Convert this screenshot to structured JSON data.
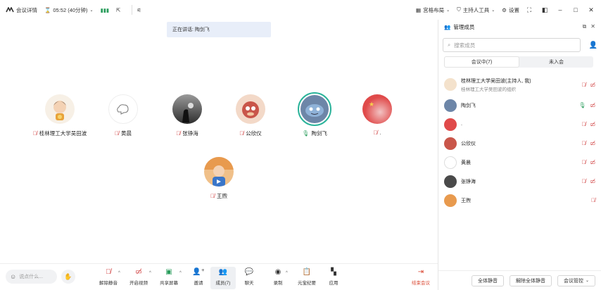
{
  "topbar": {
    "logo": "腾讯会议",
    "meeting_info": "会议详情",
    "timer": "05:52 (40分钟)",
    "layout_label": "宫格布局",
    "host_tools_label": "主持人工具",
    "settings_label": "设置"
  },
  "stage": {
    "speaking_text": "正在讲话: 陶剑飞",
    "participants": [
      {
        "name": "桂林理工大学吴田波",
        "mic": "off",
        "avatar_color": "#f4e2cc"
      },
      {
        "name": "黄晨",
        "mic": "off",
        "avatar_color": "#ffffff"
      },
      {
        "name": "张铮海",
        "mic": "off",
        "avatar_color": "#4a4a4a"
      },
      {
        "name": "公欣仪",
        "mic": "off",
        "avatar_color": "#c9564a"
      },
      {
        "name": "陶剑飞",
        "mic": "on",
        "avatar_color": "#6d86a8"
      },
      {
        "name": ".",
        "mic": "off",
        "avatar_color": "#e04a4a"
      },
      {
        "name": "王煦",
        "mic": "off",
        "avatar_color": "#e89a4e"
      }
    ]
  },
  "toolbar": {
    "chat_placeholder": "说点什么...",
    "tools": [
      {
        "label": "解除静音",
        "icon": "mic-off-icon"
      },
      {
        "label": "开启视频",
        "icon": "video-off-icon"
      },
      {
        "label": "共享屏幕",
        "icon": "share-screen-icon"
      },
      {
        "label": "邀请",
        "icon": "invite-icon"
      },
      {
        "label": "成员(7)",
        "icon": "members-icon"
      },
      {
        "label": "聊天",
        "icon": "chat-icon"
      },
      {
        "label": "录制",
        "icon": "record-icon"
      },
      {
        "label": "元宝纪要",
        "icon": "minutes-icon"
      },
      {
        "label": "应用",
        "icon": "apps-icon"
      }
    ],
    "end_label": "结束会议"
  },
  "panel": {
    "title": "管理成员",
    "search_placeholder": "搜索成员",
    "tab_in": "会议中(7)",
    "tab_out": "未入会",
    "members": [
      {
        "name": "桂林理工大学吴田波(主持人, 我)",
        "sub": "桂林理工大学吴田波的组织",
        "mic": "off",
        "color": "#f4e2cc"
      },
      {
        "name": "陶剑飞",
        "sub": "",
        "mic": "on",
        "color": "#6d86a8"
      },
      {
        "name": ".",
        "sub": "",
        "mic": "off",
        "color": "#e04a4a"
      },
      {
        "name": "公欣仪",
        "sub": "",
        "mic": "off",
        "color": "#c9564a"
      },
      {
        "name": "黄晨",
        "sub": "",
        "mic": "off",
        "color": "#ffffff"
      },
      {
        "name": "张铮海",
        "sub": "",
        "mic": "off",
        "color": "#4a4a4a"
      },
      {
        "name": "王煦",
        "sub": "",
        "mic": "off",
        "color": "#e89a4e"
      }
    ],
    "btn_mute_all": "全体静音",
    "btn_unmute_all": "解除全体静音",
    "btn_control": "会议管控"
  }
}
